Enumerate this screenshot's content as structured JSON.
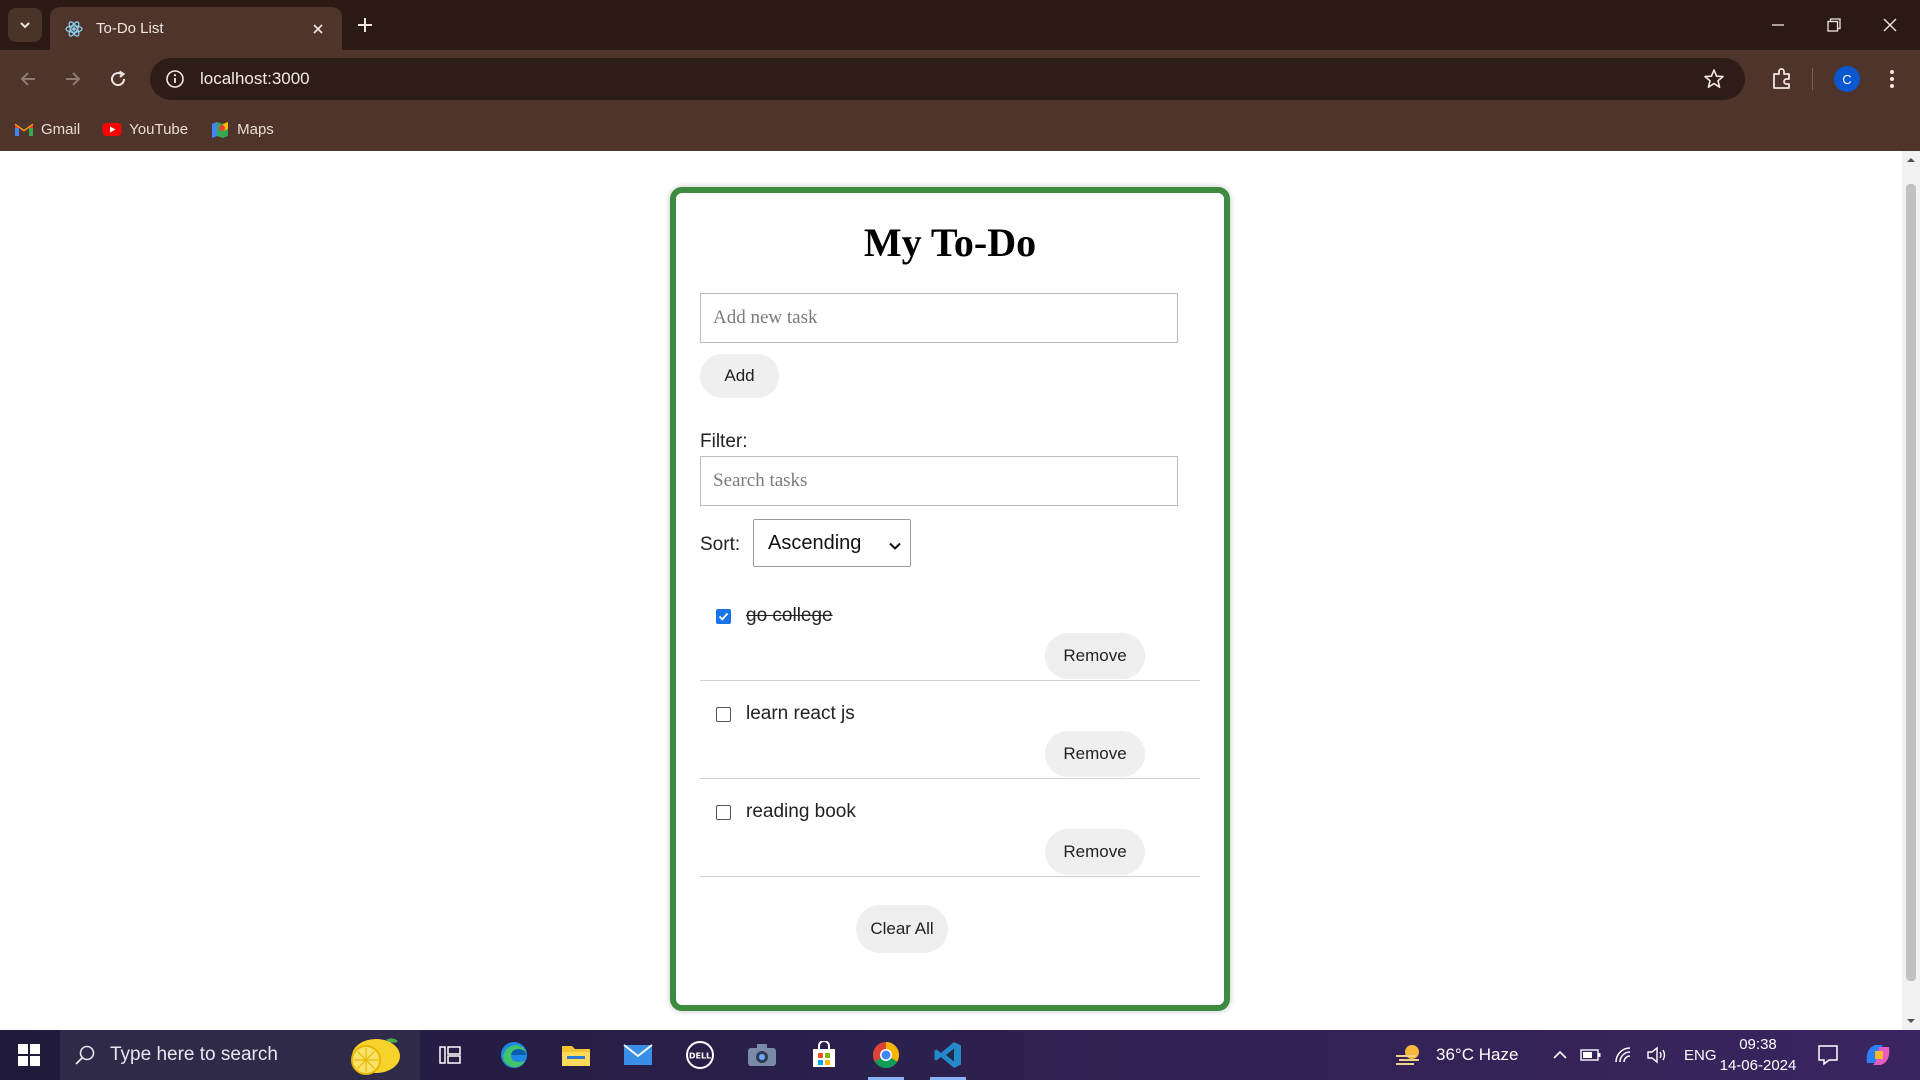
{
  "browser": {
    "tab_title": "To-Do List",
    "url": "localhost:3000",
    "profile_initial": "C",
    "bookmarks": [
      {
        "label": "Gmail",
        "icon": "gmail-icon"
      },
      {
        "label": "YouTube",
        "icon": "youtube-icon"
      },
      {
        "label": "Maps",
        "icon": "maps-icon"
      }
    ]
  },
  "app": {
    "title": "My To-Do",
    "new_task_placeholder": "Add new task",
    "add_label": "Add",
    "filter_label": "Filter:",
    "search_placeholder": "Search tasks",
    "sort_label": "Sort:",
    "sort_selected": "Ascending",
    "tasks": [
      {
        "text": "go college",
        "completed": true,
        "remove_label": "Remove"
      },
      {
        "text": "learn react js",
        "completed": false,
        "remove_label": "Remove"
      },
      {
        "text": "reading book",
        "completed": false,
        "remove_label": "Remove"
      }
    ],
    "clear_all_label": "Clear All"
  },
  "taskbar": {
    "search_placeholder": "Type here to search",
    "weather": "36°C  Haze",
    "language": "ENG",
    "time": "09:38",
    "date": "14-06-2024"
  },
  "colors": {
    "card_border": "#3d8a40",
    "chrome_frame": "#4e342a",
    "chrome_tabstrip": "#2b1a14",
    "checkbox_accent": "#1a73e8"
  }
}
